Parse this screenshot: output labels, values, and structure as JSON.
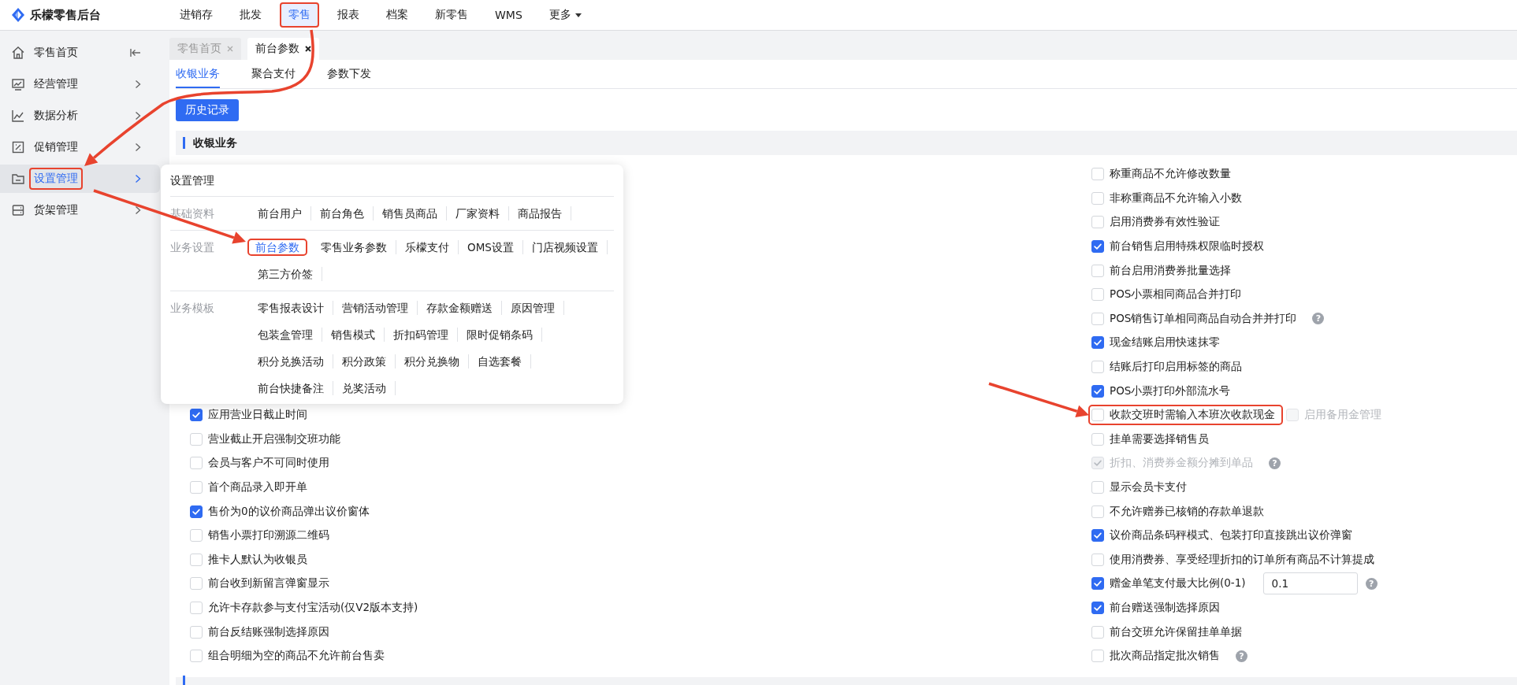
{
  "app": {
    "title": "乐檬零售后台"
  },
  "nav": [
    {
      "label": "进销存",
      "selected": false,
      "highlighted": false
    },
    {
      "label": "批发",
      "selected": false,
      "highlighted": false
    },
    {
      "label": "零售",
      "selected": true,
      "highlighted": true
    },
    {
      "label": "报表",
      "selected": false,
      "highlighted": false
    },
    {
      "label": "档案",
      "selected": false,
      "highlighted": false
    },
    {
      "label": "新零售",
      "selected": false,
      "highlighted": false
    },
    {
      "label": "WMS",
      "selected": false,
      "highlighted": false
    },
    {
      "label": "更多",
      "selected": false,
      "highlighted": false,
      "dropdown": true
    }
  ],
  "sidebar": {
    "items": [
      {
        "label": "零售首页",
        "selected": false,
        "highlighted": false,
        "expandable": false
      },
      {
        "label": "经营管理",
        "selected": false,
        "highlighted": false,
        "expandable": true
      },
      {
        "label": "数据分析",
        "selected": false,
        "highlighted": false,
        "expandable": true
      },
      {
        "label": "促销管理",
        "selected": false,
        "highlighted": false,
        "expandable": true
      },
      {
        "label": "设置管理",
        "selected": true,
        "highlighted": true,
        "expandable": true
      },
      {
        "label": "货架管理",
        "selected": false,
        "highlighted": false,
        "expandable": true
      }
    ]
  },
  "page_tabs": [
    {
      "label": "零售首页",
      "selected": false
    },
    {
      "label": "前台参数",
      "selected": true
    }
  ],
  "sub_tabs": [
    {
      "label": "收银业务",
      "selected": true
    },
    {
      "label": "聚合支付",
      "selected": false
    },
    {
      "label": "参数下发",
      "selected": false
    }
  ],
  "history_button": "历史记录",
  "section_title": "收银业务",
  "left_options": [
    {
      "label": "应用营业日截止时间",
      "checked": true
    },
    {
      "label": "营业截止开启强制交班功能",
      "checked": false
    },
    {
      "label": "会员与客户不可同时使用",
      "checked": false
    },
    {
      "label": "首个商品录入即开单",
      "checked": false
    },
    {
      "label": "售价为0的议价商品弹出议价窗体",
      "checked": true
    },
    {
      "label": "销售小票打印溯源二维码",
      "checked": false
    },
    {
      "label": "推卡人默认为收银员",
      "checked": false
    },
    {
      "label": "前台收到新留言弹窗显示",
      "checked": false
    },
    {
      "label": "允许卡存款参与支付宝活动(仅V2版本支持)",
      "checked": false
    },
    {
      "label": "前台反结账强制选择原因",
      "checked": false
    },
    {
      "label": "组合明细为空的商品不允许前台售卖",
      "checked": false
    }
  ],
  "right_options": [
    {
      "label": "称重商品不允许修改数量",
      "checked": false,
      "disabled": false,
      "highlighted": false
    },
    {
      "label": "非称重商品不允许输入小数",
      "checked": false,
      "disabled": false,
      "highlighted": false
    },
    {
      "label": "启用消费券有效性验证",
      "checked": false,
      "disabled": false,
      "highlighted": false
    },
    {
      "label": "前台销售启用特殊权限临时授权",
      "checked": true,
      "disabled": false,
      "highlighted": false
    },
    {
      "label": "前台启用消费券批量选择",
      "checked": false,
      "disabled": false,
      "highlighted": false
    },
    {
      "label": "POS小票相同商品合并打印",
      "checked": false,
      "disabled": false,
      "highlighted": false
    },
    {
      "label": "POS销售订单相同商品自动合并并打印",
      "checked": false,
      "disabled": false,
      "highlighted": false,
      "help": "?"
    },
    {
      "label": "现金结账启用快速抹零",
      "checked": true,
      "disabled": false,
      "highlighted": false
    },
    {
      "label": "结账后打印启用标签的商品",
      "checked": false,
      "disabled": false,
      "highlighted": false
    },
    {
      "label": "POS小票打印外部流水号",
      "checked": true,
      "disabled": false,
      "highlighted": false
    },
    {
      "label": "收款交班时需输入本班次收款现金",
      "checked": false,
      "disabled": false,
      "highlighted": true,
      "extra": {
        "label": "启用备用金管理",
        "checked": false,
        "disabled": true
      }
    },
    {
      "label": "挂单需要选择销售员",
      "checked": false,
      "disabled": false,
      "highlighted": false
    },
    {
      "label": "折扣、消费券金额分摊到单品",
      "checked": true,
      "disabled": true,
      "highlighted": false,
      "help": "?"
    },
    {
      "label": "显示会员卡支付",
      "checked": false,
      "disabled": false,
      "highlighted": false
    },
    {
      "label": "不允许赠券已核销的存款单退款",
      "checked": false,
      "disabled": false,
      "highlighted": false
    },
    {
      "label": "议价商品条码秤模式、包装打印直接跳出议价弹窗",
      "checked": true,
      "disabled": false,
      "highlighted": false
    },
    {
      "label": "使用消费券、享受经理折扣的订单所有商品不计算提成",
      "checked": false,
      "disabled": false,
      "highlighted": false
    },
    {
      "label": "赠金单笔支付最大比例(0-1)",
      "checked": true,
      "disabled": false,
      "highlighted": false,
      "value": "0.1",
      "help": "?"
    },
    {
      "label": "前台赠送强制选择原因",
      "checked": true,
      "disabled": false,
      "highlighted": false
    },
    {
      "label": "前台交班允许保留挂单单据",
      "checked": false,
      "disabled": false,
      "highlighted": false
    },
    {
      "label": "批次商品指定批次销售",
      "checked": false,
      "disabled": false,
      "highlighted": false,
      "help": "?"
    }
  ],
  "popup": {
    "title": "设置管理",
    "groups": [
      {
        "label": "基础资料",
        "items": [
          {
            "label": "前台用户",
            "selected": false,
            "highlighted": false
          },
          {
            "label": "前台角色",
            "selected": false,
            "highlighted": false
          },
          {
            "label": "销售员商品",
            "selected": false,
            "highlighted": false
          },
          {
            "label": "厂家资料",
            "selected": false,
            "highlighted": false
          },
          {
            "label": "商品报告",
            "selected": false,
            "highlighted": false
          }
        ]
      },
      {
        "label": "业务设置",
        "items": [
          {
            "label": "前台参数",
            "selected": true,
            "highlighted": true
          },
          {
            "label": "零售业务参数",
            "selected": false,
            "highlighted": false
          },
          {
            "label": "乐檬支付",
            "selected": false,
            "highlighted": false
          },
          {
            "label": "OMS设置",
            "selected": false,
            "highlighted": false
          },
          {
            "label": "门店视频设置",
            "selected": false,
            "highlighted": false
          },
          {
            "label": "第三方价签",
            "selected": false,
            "highlighted": false
          }
        ]
      },
      {
        "label": "业务模板",
        "items": [
          {
            "label": "零售报表设计",
            "selected": false,
            "highlighted": false
          },
          {
            "label": "营销活动管理",
            "selected": false,
            "highlighted": false
          },
          {
            "label": "存款金额赠送",
            "selected": false,
            "highlighted": false
          },
          {
            "label": "原因管理",
            "selected": false,
            "highlighted": false
          },
          {
            "label": "包装盒管理",
            "selected": false,
            "highlighted": false
          },
          {
            "label": "销售模式",
            "selected": false,
            "highlighted": false
          },
          {
            "label": "折扣码管理",
            "selected": false,
            "highlighted": false
          },
          {
            "label": "限时促销条码",
            "selected": false,
            "highlighted": false
          },
          {
            "label": "积分兑换活动",
            "selected": false,
            "highlighted": false
          },
          {
            "label": "积分政策",
            "selected": false,
            "highlighted": false
          },
          {
            "label": "积分兑换物",
            "selected": false,
            "highlighted": false
          },
          {
            "label": "自选套餐",
            "selected": false,
            "highlighted": false
          },
          {
            "label": "前台快捷备注",
            "selected": false,
            "highlighted": false
          },
          {
            "label": "兑奖活动",
            "selected": false,
            "highlighted": false
          }
        ]
      }
    ]
  }
}
